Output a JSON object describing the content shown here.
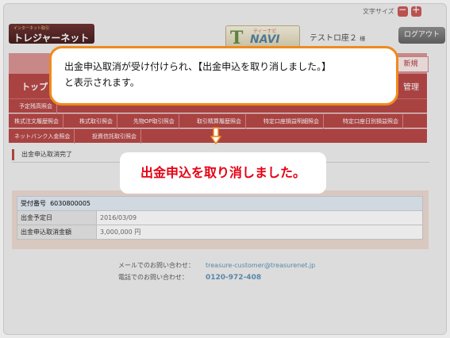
{
  "font_size": {
    "label": "文字サイズ",
    "minus": "－",
    "plus": "＋"
  },
  "logo": {
    "small_text": "インターネット取引",
    "main_text": "トレジャーネット"
  },
  "tnavi": {
    "letter": "T",
    "katakana": "ティーナビ",
    "word": "NAVI"
  },
  "account": {
    "name": "テストロ座２",
    "suffix": "様"
  },
  "logout_label": "ログアウト",
  "new_account_label": "新規",
  "nav": {
    "top_label": "トップ",
    "manage_label": "管理"
  },
  "subnav_row1": [
    "予定残高照会"
  ],
  "subnav_row2": [
    "株式注文履歴照会",
    "株式取引照会",
    "先物OP取引照会",
    "取引精算履歴照会",
    "特定口座損益明細照会",
    "特定口座日別損益照会"
  ],
  "subnav_row3": [
    "ネットバンク入金照会",
    "投資信託取引照会"
  ],
  "page_title": "出金申込取消完了",
  "receipt": {
    "label": "受付番号",
    "number": "6030800005"
  },
  "details": [
    {
      "label": "出金予定日",
      "value": "2016/03/09"
    },
    {
      "label": "出金申込取消金額",
      "value": "3,000,000 円"
    }
  ],
  "contact": {
    "mail_label": "メールでのお問い合わせ：",
    "mail": "treasure-customer@treasurenet.jp",
    "tel_label": "電話でのお問い合わせ：",
    "tel": "0120-972-408"
  },
  "callout": {
    "line1": "出金申込取消が受け付けられ、【出金申込を取り消しました。】",
    "line2": "と表示されます。"
  },
  "result_message": "出金申込を取り消しました。",
  "colors": {
    "brand_red": "#b64140",
    "callout_border": "#f08a1e",
    "result_text": "#e60012",
    "link": "#5a8fb5"
  }
}
